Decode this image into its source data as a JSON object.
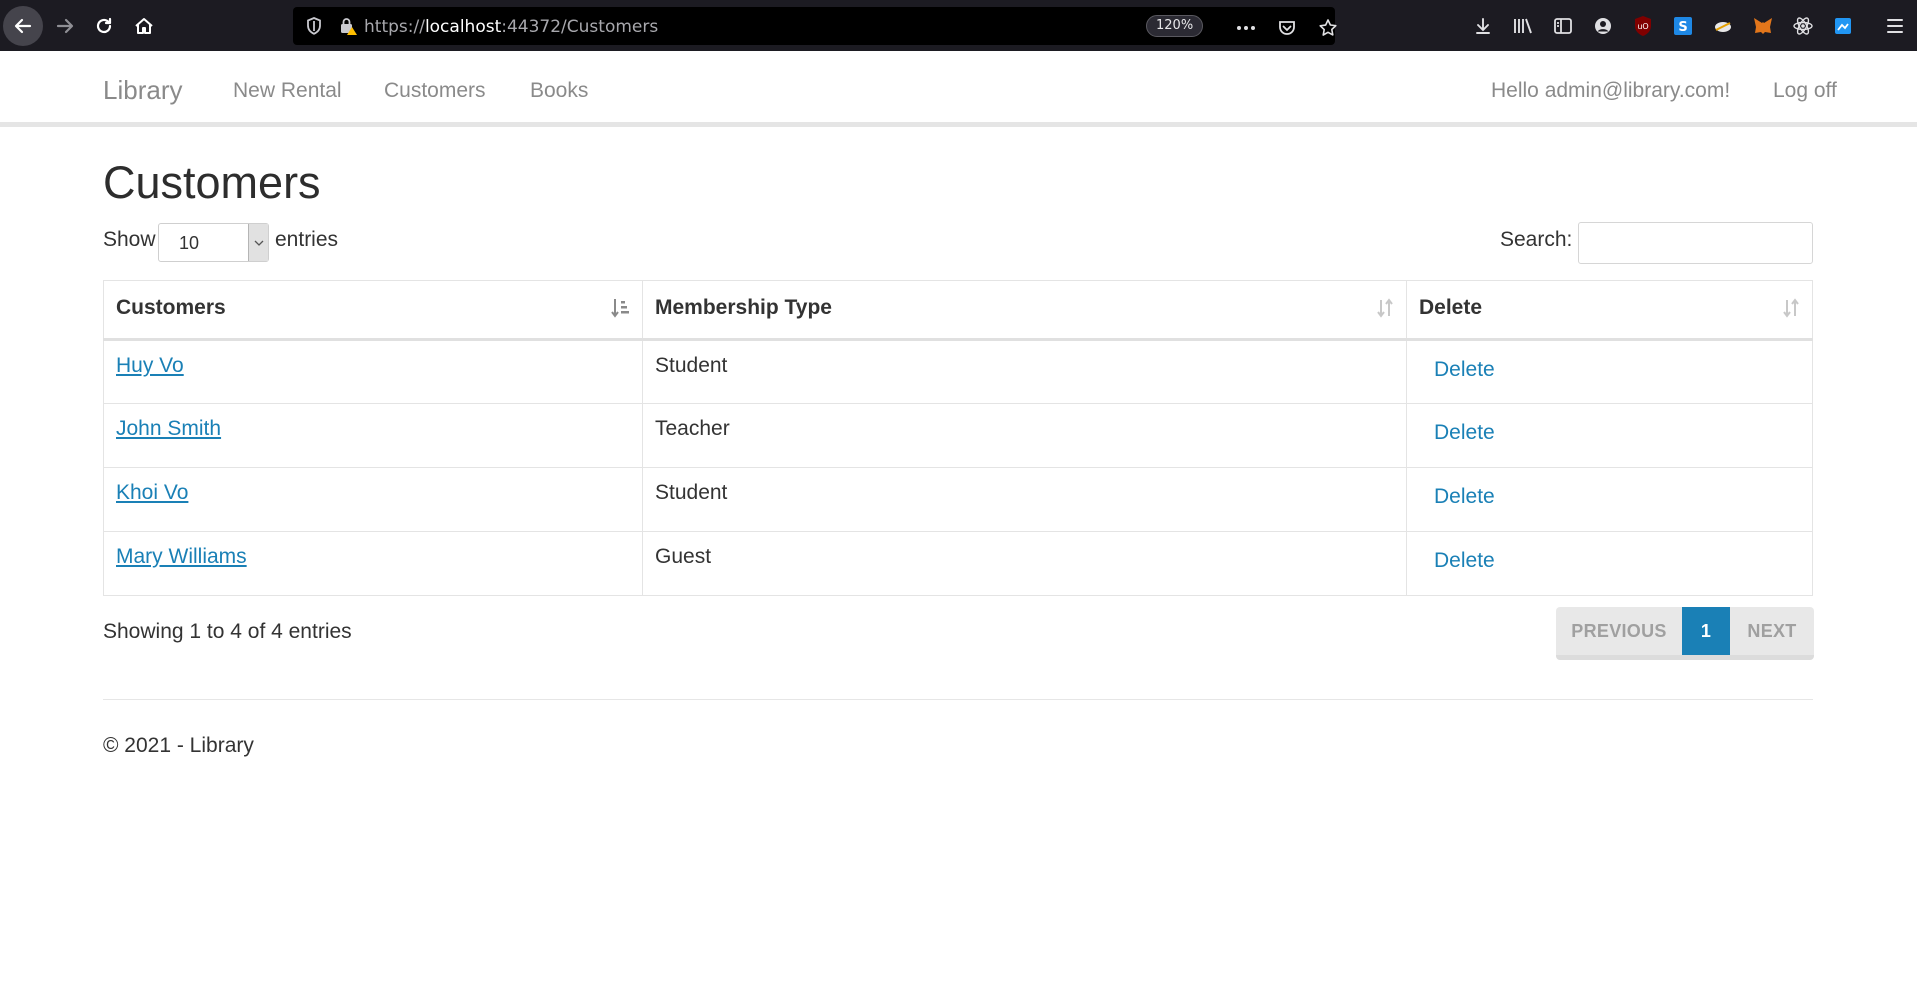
{
  "browser": {
    "url_scheme": "https://",
    "url_host": "localhost",
    "url_path": ":44372/Customers",
    "zoom": "120%",
    "icons": [
      "back-icon",
      "forward-icon",
      "reload-icon",
      "home-icon",
      "shield-icon",
      "insecure-lock-icon",
      "more-icon",
      "pocket-icon",
      "bookmark-star-icon",
      "download-icon",
      "library-icon",
      "sidebar-icon",
      "account-icon",
      "ublock-icon",
      "extension-s-icon",
      "extension-bird-icon",
      "metamask-icon",
      "react-devtools-icon",
      "extension-blue-icon",
      "menu-icon"
    ]
  },
  "navbar": {
    "brand": "Library",
    "links": [
      "New Rental",
      "Customers",
      "Books"
    ],
    "greeting": "Hello admin@library.com!",
    "logoff": "Log off"
  },
  "main": {
    "title": "Customers",
    "show_label": "Show",
    "page_length": "10",
    "entries_label": "entries",
    "search_label": "Search:",
    "search_value": "",
    "columns": [
      "Customers",
      "Membership Type",
      "Delete"
    ],
    "rows": [
      {
        "name": "Huy Vo",
        "membership": "Student",
        "action": "Delete"
      },
      {
        "name": "John Smith",
        "membership": "Teacher",
        "action": "Delete"
      },
      {
        "name": "Khoi Vo",
        "membership": "Student",
        "action": "Delete"
      },
      {
        "name": "Mary Williams",
        "membership": "Guest",
        "action": "Delete"
      }
    ],
    "info": "Showing 1 to 4 of 4 entries",
    "pagination": {
      "previous": "PREVIOUS",
      "current": "1",
      "next": "NEXT"
    }
  },
  "footer": {
    "text": "© 2021 - Library"
  },
  "colors": {
    "link": "#1a80b6",
    "chrome_bg": "#1c1b22",
    "nav_text": "#8a8a8a"
  }
}
